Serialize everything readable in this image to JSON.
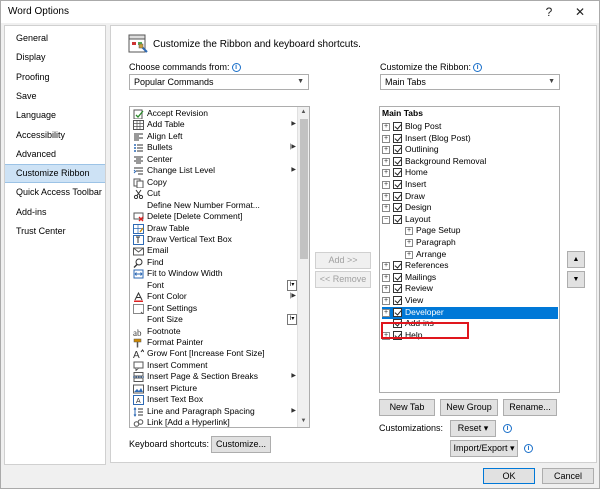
{
  "window": {
    "title": "Word Options",
    "help_glyph": "?",
    "close_glyph": "✕"
  },
  "sidebar": {
    "items": [
      {
        "label": "General"
      },
      {
        "label": "Display"
      },
      {
        "label": "Proofing"
      },
      {
        "label": "Save"
      },
      {
        "label": "Language"
      },
      {
        "label": "Accessibility"
      },
      {
        "label": "Advanced"
      },
      {
        "label": "Customize Ribbon",
        "active": true
      },
      {
        "label": "Quick Access Toolbar"
      },
      {
        "label": "Add-ins"
      },
      {
        "label": "Trust Center"
      }
    ]
  },
  "main": {
    "header": "Customize the Ribbon and keyboard shortcuts.",
    "choose_label": "Choose commands from:",
    "choose_value": "Popular Commands",
    "customize_label": "Customize the Ribbon:",
    "customize_value": "Main Tabs",
    "commands": [
      {
        "label": "Accept Revision",
        "icon": "accept-revision-icon"
      },
      {
        "label": "Add Table",
        "icon": "table-icon",
        "submenu": true
      },
      {
        "label": "Align Left",
        "icon": "align-left-icon"
      },
      {
        "label": "Bullets",
        "icon": "bullets-icon",
        "split": true
      },
      {
        "label": "Center",
        "icon": "center-align-icon"
      },
      {
        "label": "Change List Level",
        "icon": "list-level-icon",
        "submenu": true
      },
      {
        "label": "Copy",
        "icon": "copy-icon"
      },
      {
        "label": "Cut",
        "icon": "cut-icon"
      },
      {
        "label": "Define New Number Format...",
        "icon": ""
      },
      {
        "label": "Delete [Delete Comment]",
        "icon": "delete-comment-icon"
      },
      {
        "label": "Draw Table",
        "icon": "draw-table-icon"
      },
      {
        "label": "Draw Vertical Text Box",
        "icon": "vertical-text-box-icon"
      },
      {
        "label": "Email",
        "icon": "email-icon"
      },
      {
        "label": "Find",
        "icon": "find-icon"
      },
      {
        "label": "Fit to Window Width",
        "icon": "fit-width-icon"
      },
      {
        "label": "Font",
        "icon": "",
        "box": true
      },
      {
        "label": "Font Color",
        "icon": "font-color-icon",
        "split": true
      },
      {
        "label": "Font Settings",
        "icon": "font-settings-icon"
      },
      {
        "label": "Font Size",
        "icon": "",
        "box": true
      },
      {
        "label": "Footnote",
        "icon": "footnote-icon"
      },
      {
        "label": "Format Painter",
        "icon": "format-painter-icon"
      },
      {
        "label": "Grow Font [Increase Font Size]",
        "icon": "grow-font-icon"
      },
      {
        "label": "Insert Comment",
        "icon": "insert-comment-icon"
      },
      {
        "label": "Insert Page & Section Breaks",
        "icon": "page-break-icon",
        "submenu": true
      },
      {
        "label": "Insert Picture",
        "icon": "picture-icon"
      },
      {
        "label": "Insert Text Box",
        "icon": "text-box-icon"
      },
      {
        "label": "Line and Paragraph Spacing",
        "icon": "line-spacing-icon",
        "submenu": true
      },
      {
        "label": "Link [Add a Hyperlink]",
        "icon": "link-icon"
      }
    ],
    "add_button": "Add >>",
    "remove_button": "<< Remove",
    "ribbon_header": "Main Tabs",
    "tabs": [
      {
        "label": "Blog Post",
        "exp": "+",
        "checked": true
      },
      {
        "label": "Insert (Blog Post)",
        "exp": "+",
        "checked": true
      },
      {
        "label": "Outlining",
        "exp": "+",
        "checked": true
      },
      {
        "label": "Background Removal",
        "exp": "+",
        "checked": true
      },
      {
        "label": "Home",
        "exp": "+",
        "checked": true
      },
      {
        "label": "Insert",
        "exp": "+",
        "checked": true
      },
      {
        "label": "Draw",
        "exp": "+",
        "checked": true
      },
      {
        "label": "Design",
        "exp": "+",
        "checked": true
      },
      {
        "label": "Layout",
        "exp": "−",
        "checked": true
      },
      {
        "label": "Page Setup",
        "exp": "+",
        "sub": true
      },
      {
        "label": "Paragraph",
        "exp": "+",
        "sub": true
      },
      {
        "label": "Arrange",
        "exp": "+",
        "sub": true
      },
      {
        "label": "References",
        "exp": "+",
        "checked": true
      },
      {
        "label": "Mailings",
        "exp": "+",
        "checked": true
      },
      {
        "label": "Review",
        "exp": "+",
        "checked": true
      },
      {
        "label": "View",
        "exp": "+",
        "checked": true
      },
      {
        "label": "Developer",
        "exp": "+",
        "checked": true,
        "selected": true
      },
      {
        "label": "Add-ins",
        "exp": "",
        "checked": true
      },
      {
        "label": "Help",
        "exp": "+",
        "checked": true
      }
    ],
    "new_tab": "New Tab",
    "new_group": "New Group",
    "rename": "Rename...",
    "customizations_label": "Customizations:",
    "reset_button": "Reset ▾",
    "import_export_button": "Import/Export ▾",
    "keyboard_label": "Keyboard shortcuts:",
    "customize_button": "Customize..."
  },
  "footer": {
    "ok": "OK",
    "cancel": "Cancel"
  },
  "colors": {
    "selection": "#0078d7",
    "highlight": "#e0161d",
    "sidebar_active": "#cde2f5"
  }
}
